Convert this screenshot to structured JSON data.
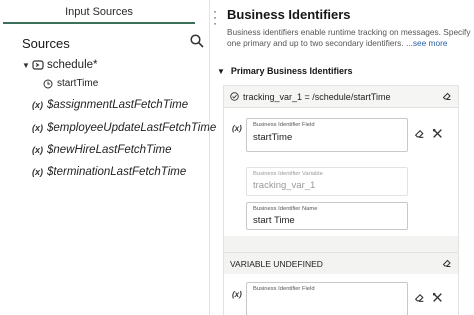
{
  "left_panel": {
    "tab_label": "Input Sources",
    "sources_title": "Sources",
    "tree": {
      "root_label": "schedule",
      "root_marker": "*",
      "root_child": "startTime",
      "variables": [
        "$assignmentLastFetchTime",
        "$employeeUpdateLastFetchTime",
        "$newHireLastFetchTime",
        "$terminationLastFetchTime"
      ],
      "var_prefix": "(x)"
    }
  },
  "right_panel": {
    "title": "Business Identifiers",
    "description": "Business identifiers enable runtime tracking on messages. Specify one primary and up to two secondary identifiers. ",
    "see_more": "...see more",
    "section_title": "Primary Business Identifiers",
    "primary_row": "tracking_var_1 = /schedule/startTime",
    "x_label": "(x)",
    "field_identifier": {
      "label": "Business Identifier Field",
      "value": "startTime"
    },
    "field_variable": {
      "label": "Business Identifier Variable",
      "value": "tracking_var_1"
    },
    "field_name": {
      "label": "Business Identifier Name",
      "value": "start Time"
    },
    "undefined_label": "VARIABLE UNDEFINED",
    "field_identifier_2": {
      "label": "Business Identifier Field",
      "value": ""
    }
  },
  "colors": {
    "tab_underline": "#3d6f5a",
    "link": "#2a5ea8"
  }
}
